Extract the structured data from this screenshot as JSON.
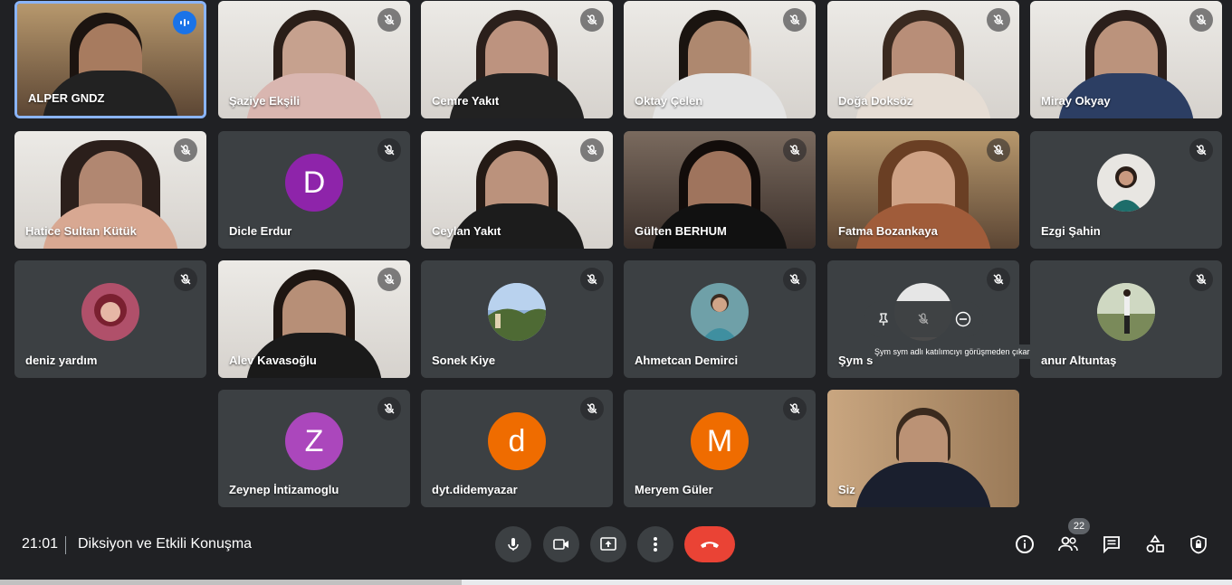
{
  "participants": [
    {
      "name": "ALPER GNDZ",
      "speaking": true
    },
    {
      "name": "Şaziye Ekşili"
    },
    {
      "name": "Cemre Yakıt"
    },
    {
      "name": "Oktay Çelen"
    },
    {
      "name": "Doğa Doksöz"
    },
    {
      "name": "Miray Okyay"
    },
    {
      "name": "Hatice Sultan Kütük"
    },
    {
      "name": "Dicle Erdur",
      "initial": "D",
      "avatar_color": "#8e24aa"
    },
    {
      "name": "Ceylan Yakıt"
    },
    {
      "name": "Gülten BERHUM"
    },
    {
      "name": "Fatma Bozankaya"
    },
    {
      "name": "Ezgi Şahin"
    },
    {
      "name": "deniz yardım"
    },
    {
      "name": "Alev Kavasoğlu"
    },
    {
      "name": "Sonek Kiye"
    },
    {
      "name": "Ahmetcan Demirci"
    },
    {
      "name": "Şym s"
    },
    {
      "name": "anur Altuntaş"
    },
    {
      "name": "Zeynep İntizamoglu",
      "initial": "Z",
      "avatar_color": "#ab47bc"
    },
    {
      "name": "dyt.didemyazar",
      "initial": "d",
      "avatar_color": "#ef6c00"
    },
    {
      "name": "Meryem Güler",
      "initial": "M",
      "avatar_color": "#ef6c00"
    },
    {
      "name": "Siz"
    }
  ],
  "tooltip": "Şym sym adlı katılımcıyı görüşmeden çıkar",
  "hover_controls": [
    "pin-icon",
    "mic-off-icon",
    "remove-icon"
  ],
  "meeting": {
    "time": "21:01",
    "title": "Diksiyon ve Etkili Konuşma"
  },
  "controls": [
    "mic-icon",
    "camera-icon",
    "present-icon",
    "more-icon",
    "hangup-icon"
  ],
  "right_controls": {
    "participant_count": "22",
    "icons": [
      "info-icon",
      "people-icon",
      "chat-icon",
      "activities-icon",
      "host-controls-icon"
    ]
  },
  "colors": {
    "background": "#202124",
    "tile": "#3c4043",
    "accent": "#8ab4f8",
    "hangup": "#ea4335"
  }
}
